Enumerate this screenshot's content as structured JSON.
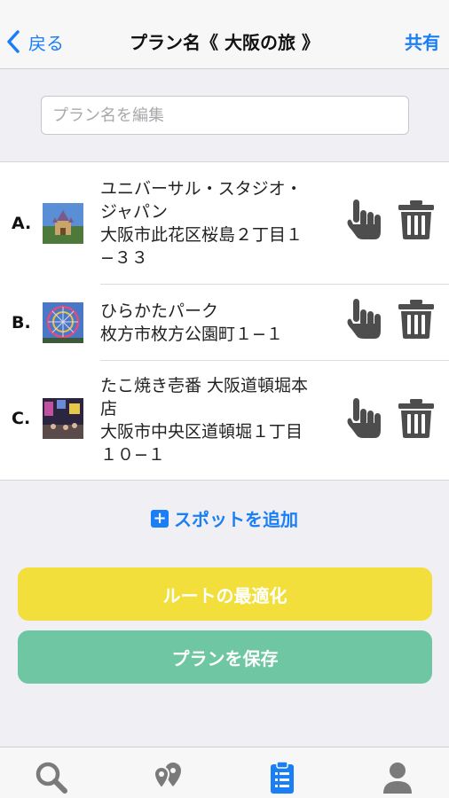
{
  "nav": {
    "back_label": "戻る",
    "title": "プラン名《 大阪の旅 》",
    "share_label": "共有"
  },
  "plan_name_input": {
    "value": "",
    "placeholder": "プラン名を編集"
  },
  "spots": [
    {
      "letter": "A.",
      "name": "ユニバーサル・スタジオ・ジャパン",
      "name_lines": [
        "ユニバーサル・スタジオ・",
        "ジャパン"
      ],
      "address_lines": [
        "大阪市此花区桜島２丁目１",
        "−３３"
      ],
      "thumb_icon": "castle-photo"
    },
    {
      "letter": "B.",
      "name": "ひらかたパーク",
      "name_lines": [
        "ひらかたパーク"
      ],
      "address_lines": [
        "枚方市枚方公園町１−１"
      ],
      "thumb_icon": "ferris-wheel-photo"
    },
    {
      "letter": "C.",
      "name": "たこ焼き壱番 大阪道頓堀本店",
      "name_lines": [
        "たこ焼き壱番 大阪道頓堀本",
        "店"
      ],
      "address_lines": [
        "大阪市中央区道頓堀１丁目",
        "１０−１"
      ],
      "thumb_icon": "street-night-photo"
    }
  ],
  "add_spot_label": "スポットを追加",
  "optimize_button_label": "ルートの最適化",
  "save_button_label": "プランを保存",
  "tabbar": {
    "items": [
      {
        "icon": "search-icon",
        "active": false
      },
      {
        "icon": "map-pins-icon",
        "active": false
      },
      {
        "icon": "clipboard-list-icon",
        "active": true
      },
      {
        "icon": "user-icon",
        "active": false
      }
    ]
  },
  "colors": {
    "accent": "#1a7ef5",
    "optimize_button": "#f2df3b",
    "save_button": "#6fc6a2",
    "icon_gray": "#4d4d4d"
  }
}
